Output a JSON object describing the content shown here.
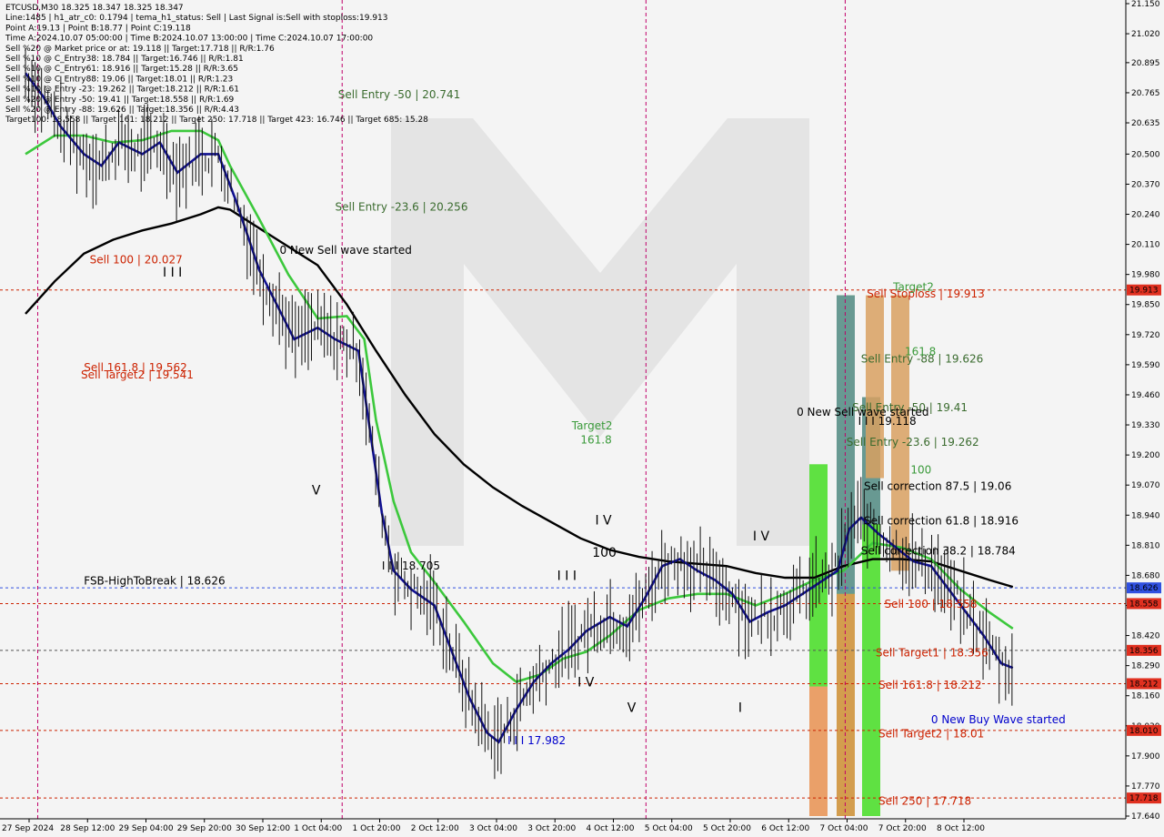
{
  "colors": {
    "background": "#f4f4f4",
    "sell": "#cc2200",
    "sell_text_green": "#3a6b2e",
    "buy": "#0000cc",
    "ma_black": "#000000",
    "ma_green": "#3cc83c",
    "ma_blue": "#101090",
    "price_orange": "#ff6600",
    "vline": "#c0006a",
    "axis_highlight_red": "#e03020",
    "axis_highlight_blue": "#3050e0",
    "zone_green": "#44dd22",
    "zone_orange": "#e89050",
    "zone_bluegray": "#6a8ca0",
    "zone_tan": "#d8a060"
  },
  "header": {
    "lines": [
      "ETCUSD,M30  18.325 18.347 18.325 18.347",
      "Line:1485 | h1_atr_c0: 0.1794 | tema_h1_status: Sell | Last Signal is:Sell with stoploss:19.913",
      "Point A:19.13 | Point B:18.77 | Point C:19.118",
      "Time A:2024.10.07 05:00:00 | Time B:2024.10.07 13:00:00 | Time C:2024.10.07 17:00:00",
      "Sell %20 @ Market price or at: 19.118 || Target:17.718 || R/R:1.76",
      "Sell %10 @ C_Entry38: 18.784 || Target:16.746 || R/R:1.81",
      "Sell %10 @ C_Entry61: 18.916 || Target:15.28 || R/R:3.65",
      "Sell %10 @ C_Entry88: 19.06 || Target:18.01 || R/R:1.23",
      "Sell %10 @ Entry -23: 19.262 || Target:18.212 || R/R:1.61",
      "Sell %20 @ Entry -50: 19.41 || Target:18.558 || R/R:1.69",
      "Sell %20 @ Entry -88: 19.626 || Target:18.356 || R/R:4.43",
      "Target100: 18.558 || Target 161: 18.212 || Target 250: 17.718 || Target 423: 16.746 || Target 685: 15.28"
    ]
  },
  "chart_data": {
    "type": "line",
    "symbol": "ETCUSD,M30",
    "ylim": [
      17.64,
      21.15
    ],
    "y_ticks": [
      21.15,
      21.02,
      20.895,
      20.765,
      20.635,
      20.5,
      20.37,
      20.24,
      20.11,
      19.98,
      19.85,
      19.72,
      19.59,
      19.46,
      19.33,
      19.2,
      19.07,
      18.94,
      18.81,
      18.68,
      18.55,
      18.42,
      18.29,
      18.16,
      18.03,
      17.9,
      17.77,
      17.64
    ],
    "y_tick_labels": [
      "21.150",
      "21.020",
      "20.895",
      "20.765",
      "20.635",
      "20.500",
      "20.370",
      "20.240",
      "20.110",
      "19.980",
      "19.850",
      "19.720",
      "19.590",
      "19.460",
      "19.330",
      "19.200",
      "19.070",
      "18.940",
      "18.810",
      "18.680",
      "18.550",
      "18.420",
      "18.290",
      "18.160",
      "18.030",
      "17.900",
      "17.770",
      "17.640"
    ],
    "x_tick_labels": [
      "27 Sep 2024",
      "28 Sep 12:00",
      "29 Sep 04:00",
      "29 Sep 20:00",
      "30 Sep 12:00",
      "1 Oct 04:00",
      "1 Oct 20:00",
      "2 Oct 12:00",
      "3 Oct 04:00",
      "3 Oct 20:00",
      "4 Oct 12:00",
      "5 Oct 04:00",
      "5 Oct 20:00",
      "6 Oct 12:00",
      "7 Oct 04:00",
      "7 Oct 20:00",
      "8 Oct 12:00"
    ],
    "price_tags": [
      {
        "value": 19.913,
        "label": "19.913",
        "color": "#e03020"
      },
      {
        "value": 18.626,
        "label": "18.626",
        "color": "#3050e0"
      },
      {
        "value": 18.558,
        "label": "18.558",
        "color": "#e03020"
      },
      {
        "value": 18.356,
        "label": "18.356",
        "color": "#e03020"
      },
      {
        "value": 18.212,
        "label": "18.212",
        "color": "#e03020"
      },
      {
        "value": 18.01,
        "label": "18.010",
        "color": "#e03020"
      },
      {
        "value": 17.718,
        "label": "17.718",
        "color": "#e03020"
      }
    ],
    "levels": [
      {
        "value": 19.913,
        "style": "dashed",
        "color": "#cc2200"
      },
      {
        "value": 18.626,
        "style": "dashed",
        "color": "#3050e0"
      },
      {
        "value": 18.558,
        "style": "dashed",
        "color": "#cc2200"
      },
      {
        "value": 18.356,
        "style": "dashed",
        "color": "#555555"
      },
      {
        "value": 18.212,
        "style": "dashed",
        "color": "#cc2200"
      },
      {
        "value": 18.01,
        "style": "dashed",
        "color": "#cc2200"
      },
      {
        "value": 17.718,
        "style": "dashed",
        "color": "#cc2200"
      }
    ],
    "annotations": [
      {
        "text": "Sell Entry -50 | 20.741",
        "x_index": 5.35,
        "y": 20.741,
        "color": "#3a6b2e"
      },
      {
        "text": "Sell Entry -23.6 | 20.256",
        "x_index": 5.3,
        "y": 20.256,
        "color": "#3a6b2e"
      },
      {
        "text": "Sell 100 | 20.027",
        "x_index": 1.1,
        "y": 20.027,
        "color": "#cc2200"
      },
      {
        "text": "0 New Sell wave started",
        "x_index": 4.35,
        "y": 20.07,
        "color": "#000000"
      },
      {
        "text": "Sell 161.8 | 19.562",
        "x_index": 1.0,
        "y": 19.562,
        "color": "#cc2200"
      },
      {
        "text": "Sell Target2 | 19.541",
        "x_index": 0.95,
        "y": 19.53,
        "color": "#cc2200"
      },
      {
        "text": "Target2",
        "x_index": 9.35,
        "y": 19.31,
        "color": "#3a9a3a"
      },
      {
        "text": "161.8",
        "x_index": 9.5,
        "y": 19.25,
        "color": "#3a9a3a"
      },
      {
        "text": "FSB-HighToBreak | 18.626",
        "x_index": 1.0,
        "y": 18.64,
        "color": "#000000"
      },
      {
        "text": "I I I 18.705",
        "x_index": 6.1,
        "y": 18.705,
        "color": "#000000"
      },
      {
        "text": "I I I 17.982",
        "x_index": 8.25,
        "y": 17.95,
        "color": "#0000cc"
      },
      {
        "text": "Sell Stoploss | 19.913",
        "x_index": 14.4,
        "y": 19.88,
        "color": "#cc2200"
      },
      {
        "text": "Target2",
        "x_index": 14.85,
        "y": 19.91,
        "color": "#3a9a3a"
      },
      {
        "text": "Sell Entry -88 | 19.626",
        "x_index": 14.3,
        "y": 19.6,
        "color": "#3a6b2e"
      },
      {
        "text": "161.8",
        "x_index": 15.05,
        "y": 19.63,
        "color": "#3a9a3a"
      },
      {
        "text": "Sell Entry -50 | 19.41",
        "x_index": 14.15,
        "y": 19.39,
        "color": "#3a6b2e"
      },
      {
        "text": "0 New Sell wave started",
        "x_index": 13.2,
        "y": 19.37,
        "color": "#000000"
      },
      {
        "text": "I I I 19.118",
        "x_index": 14.25,
        "y": 19.33,
        "color": "#000000"
      },
      {
        "text": "Sell Entry -23.6 | 19.262",
        "x_index": 14.05,
        "y": 19.24,
        "color": "#3a6b2e"
      },
      {
        "text": "100",
        "x_index": 15.15,
        "y": 19.12,
        "color": "#3a9a3a"
      },
      {
        "text": "Sell correction 87.5 | 19.06",
        "x_index": 14.35,
        "y": 19.05,
        "color": "#000000"
      },
      {
        "text": "Sell correction 61.8 | 18.916",
        "x_index": 14.35,
        "y": 18.9,
        "color": "#000000"
      },
      {
        "text": "Sell correction 38.2 | 18.784",
        "x_index": 14.3,
        "y": 18.77,
        "color": "#000000"
      },
      {
        "text": "Sell 100 | 18.558",
        "x_index": 14.7,
        "y": 18.54,
        "color": "#cc2200"
      },
      {
        "text": "Sell Target1 | 18.356",
        "x_index": 14.55,
        "y": 18.33,
        "color": "#cc2200"
      },
      {
        "text": "Sell 161.8 | 18.212",
        "x_index": 14.6,
        "y": 18.19,
        "color": "#cc2200"
      },
      {
        "text": "0 New Buy Wave started",
        "x_index": 15.5,
        "y": 18.04,
        "color": "#0000cc"
      },
      {
        "text": "Sell Target2 | 18.01",
        "x_index": 14.6,
        "y": 17.98,
        "color": "#cc2200"
      },
      {
        "text": "Sell 250 | 17.718",
        "x_index": 14.6,
        "y": 17.69,
        "color": "#cc2200"
      }
    ],
    "wave_labels": [
      {
        "text": "I I I",
        "x_index": 2.35,
        "y": 19.97
      },
      {
        "text": "V",
        "x_index": 4.9,
        "y": 19.03
      },
      {
        "text": "I V",
        "x_index": 9.75,
        "y": 18.9
      },
      {
        "text": "I I I",
        "x_index": 9.1,
        "y": 18.66
      },
      {
        "text": "100",
        "x_index": 9.7,
        "y": 18.76
      },
      {
        "text": "I V",
        "x_index": 9.45,
        "y": 18.2
      },
      {
        "text": "V",
        "x_index": 10.3,
        "y": 18.09
      },
      {
        "text": "I V",
        "x_index": 12.45,
        "y": 18.83
      },
      {
        "text": "I",
        "x_index": 12.2,
        "y": 18.09
      }
    ],
    "vertical_lines_x_index": [
      0.21,
      5.42,
      10.62,
      14.03
    ],
    "series": [
      {
        "name": "slow_ma_black",
        "color": "#000000",
        "values": [
          [
            0,
            19.81
          ],
          [
            0.5,
            19.95
          ],
          [
            1,
            20.07
          ],
          [
            1.5,
            20.13
          ],
          [
            2,
            20.17
          ],
          [
            2.5,
            20.2
          ],
          [
            3,
            20.24
          ],
          [
            3.3,
            20.27
          ],
          [
            3.5,
            20.26
          ],
          [
            4,
            20.18
          ],
          [
            4.5,
            20.1
          ],
          [
            5,
            20.02
          ],
          [
            5.5,
            19.85
          ],
          [
            6,
            19.65
          ],
          [
            6.5,
            19.46
          ],
          [
            7,
            19.29
          ],
          [
            7.5,
            19.16
          ],
          [
            8,
            19.06
          ],
          [
            8.5,
            18.98
          ],
          [
            9,
            18.91
          ],
          [
            9.5,
            18.84
          ],
          [
            10,
            18.79
          ],
          [
            10.5,
            18.76
          ],
          [
            11,
            18.74
          ],
          [
            11.5,
            18.73
          ],
          [
            12,
            18.72
          ],
          [
            12.5,
            18.69
          ],
          [
            13,
            18.67
          ],
          [
            13.5,
            18.67
          ],
          [
            14,
            18.72
          ],
          [
            14.5,
            18.75
          ],
          [
            15,
            18.75
          ],
          [
            15.5,
            18.74
          ],
          [
            16,
            18.7
          ],
          [
            16.5,
            18.66
          ],
          [
            16.9,
            18.63
          ]
        ]
      },
      {
        "name": "mid_ma_green",
        "color": "#3cc83c",
        "values": [
          [
            0,
            20.5
          ],
          [
            0.5,
            20.58
          ],
          [
            1,
            20.58
          ],
          [
            1.5,
            20.55
          ],
          [
            2,
            20.56
          ],
          [
            2.5,
            20.6
          ],
          [
            3,
            20.6
          ],
          [
            3.3,
            20.56
          ],
          [
            3.5,
            20.45
          ],
          [
            4,
            20.22
          ],
          [
            4.5,
            19.98
          ],
          [
            5,
            19.79
          ],
          [
            5.5,
            19.8
          ],
          [
            5.8,
            19.7
          ],
          [
            6,
            19.35
          ],
          [
            6.3,
            19.0
          ],
          [
            6.6,
            18.78
          ],
          [
            7,
            18.65
          ],
          [
            7.5,
            18.48
          ],
          [
            8,
            18.3
          ],
          [
            8.4,
            18.22
          ],
          [
            8.8,
            18.25
          ],
          [
            9.2,
            18.32
          ],
          [
            9.6,
            18.35
          ],
          [
            10,
            18.42
          ],
          [
            10.5,
            18.53
          ],
          [
            11,
            18.58
          ],
          [
            11.5,
            18.6
          ],
          [
            12,
            18.6
          ],
          [
            12.5,
            18.55
          ],
          [
            13,
            18.6
          ],
          [
            13.5,
            18.66
          ],
          [
            14,
            18.7
          ],
          [
            14.5,
            18.82
          ],
          [
            15,
            18.8
          ],
          [
            15.5,
            18.75
          ],
          [
            16,
            18.62
          ],
          [
            16.5,
            18.52
          ],
          [
            16.9,
            18.45
          ]
        ]
      },
      {
        "name": "fast_ma_blue",
        "color": "#101090",
        "values": [
          [
            0,
            20.85
          ],
          [
            0.3,
            20.75
          ],
          [
            0.6,
            20.62
          ],
          [
            1,
            20.5
          ],
          [
            1.3,
            20.45
          ],
          [
            1.6,
            20.55
          ],
          [
            2,
            20.5
          ],
          [
            2.3,
            20.55
          ],
          [
            2.6,
            20.42
          ],
          [
            3,
            20.5
          ],
          [
            3.3,
            20.5
          ],
          [
            3.6,
            20.3
          ],
          [
            4,
            20.0
          ],
          [
            4.3,
            19.85
          ],
          [
            4.6,
            19.7
          ],
          [
            5,
            19.75
          ],
          [
            5.3,
            19.7
          ],
          [
            5.7,
            19.65
          ],
          [
            5.9,
            19.3
          ],
          [
            6.1,
            18.95
          ],
          [
            6.3,
            18.7
          ],
          [
            6.6,
            18.62
          ],
          [
            7,
            18.55
          ],
          [
            7.3,
            18.35
          ],
          [
            7.6,
            18.15
          ],
          [
            7.9,
            18.0
          ],
          [
            8.1,
            17.96
          ],
          [
            8.4,
            18.1
          ],
          [
            8.7,
            18.22
          ],
          [
            9,
            18.3
          ],
          [
            9.3,
            18.36
          ],
          [
            9.6,
            18.44
          ],
          [
            10,
            18.5
          ],
          [
            10.3,
            18.46
          ],
          [
            10.6,
            18.58
          ],
          [
            10.9,
            18.72
          ],
          [
            11.2,
            18.75
          ],
          [
            11.5,
            18.7
          ],
          [
            11.8,
            18.66
          ],
          [
            12.1,
            18.6
          ],
          [
            12.4,
            18.48
          ],
          [
            12.7,
            18.52
          ],
          [
            13,
            18.55
          ],
          [
            13.3,
            18.6
          ],
          [
            13.6,
            18.65
          ],
          [
            13.9,
            18.7
          ],
          [
            14.1,
            18.88
          ],
          [
            14.3,
            18.93
          ],
          [
            14.6,
            18.86
          ],
          [
            14.9,
            18.8
          ],
          [
            15.2,
            18.74
          ],
          [
            15.5,
            18.72
          ],
          [
            15.8,
            18.62
          ],
          [
            16.1,
            18.52
          ],
          [
            16.4,
            18.42
          ],
          [
            16.7,
            18.3
          ],
          [
            16.9,
            18.28
          ]
        ]
      }
    ]
  }
}
